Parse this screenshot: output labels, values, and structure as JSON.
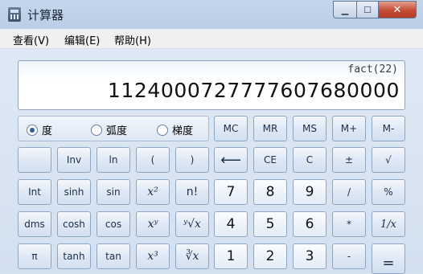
{
  "window": {
    "title": "计算器"
  },
  "menu": [
    "查看(V)",
    "编辑(E)",
    "帮助(H)"
  ],
  "display": {
    "expression": "fact(22)",
    "result": "1124000727777607680000"
  },
  "angle_units": {
    "options": [
      "度",
      "弧度",
      "梯度"
    ],
    "selected": "度"
  },
  "memory_keys": [
    "MC",
    "MR",
    "MS",
    "M+",
    "M-"
  ],
  "rows": [
    [
      "",
      "Inv",
      "ln",
      "(",
      ")",
      "⟵",
      "CE",
      "C",
      "±",
      "√"
    ],
    [
      "Int",
      "sinh",
      "sin",
      "x²",
      "n!",
      "7",
      "8",
      "9",
      "/",
      "%"
    ],
    [
      "dms",
      "cosh",
      "cos",
      "xʸ",
      "ʸ√x",
      "4",
      "5",
      "6",
      "*",
      "1/x"
    ],
    [
      "π",
      "tanh",
      "tan",
      "x³",
      "∛x",
      "1",
      "2",
      "3",
      "-",
      "="
    ]
  ]
}
